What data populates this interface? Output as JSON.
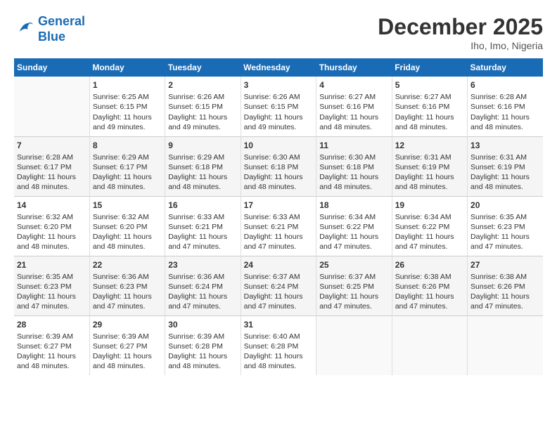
{
  "header": {
    "logo_line1": "General",
    "logo_line2": "Blue",
    "month": "December 2025",
    "location": "Iho, Imo, Nigeria"
  },
  "weekdays": [
    "Sunday",
    "Monday",
    "Tuesday",
    "Wednesday",
    "Thursday",
    "Friday",
    "Saturday"
  ],
  "rows": [
    [
      {
        "day": "",
        "sunrise": "",
        "sunset": "",
        "daylight": ""
      },
      {
        "day": "1",
        "sunrise": "Sunrise: 6:25 AM",
        "sunset": "Sunset: 6:15 PM",
        "daylight": "Daylight: 11 hours and 49 minutes."
      },
      {
        "day": "2",
        "sunrise": "Sunrise: 6:26 AM",
        "sunset": "Sunset: 6:15 PM",
        "daylight": "Daylight: 11 hours and 49 minutes."
      },
      {
        "day": "3",
        "sunrise": "Sunrise: 6:26 AM",
        "sunset": "Sunset: 6:15 PM",
        "daylight": "Daylight: 11 hours and 49 minutes."
      },
      {
        "day": "4",
        "sunrise": "Sunrise: 6:27 AM",
        "sunset": "Sunset: 6:16 PM",
        "daylight": "Daylight: 11 hours and 48 minutes."
      },
      {
        "day": "5",
        "sunrise": "Sunrise: 6:27 AM",
        "sunset": "Sunset: 6:16 PM",
        "daylight": "Daylight: 11 hours and 48 minutes."
      },
      {
        "day": "6",
        "sunrise": "Sunrise: 6:28 AM",
        "sunset": "Sunset: 6:16 PM",
        "daylight": "Daylight: 11 hours and 48 minutes."
      }
    ],
    [
      {
        "day": "7",
        "sunrise": "Sunrise: 6:28 AM",
        "sunset": "Sunset: 6:17 PM",
        "daylight": "Daylight: 11 hours and 48 minutes."
      },
      {
        "day": "8",
        "sunrise": "Sunrise: 6:29 AM",
        "sunset": "Sunset: 6:17 PM",
        "daylight": "Daylight: 11 hours and 48 minutes."
      },
      {
        "day": "9",
        "sunrise": "Sunrise: 6:29 AM",
        "sunset": "Sunset: 6:18 PM",
        "daylight": "Daylight: 11 hours and 48 minutes."
      },
      {
        "day": "10",
        "sunrise": "Sunrise: 6:30 AM",
        "sunset": "Sunset: 6:18 PM",
        "daylight": "Daylight: 11 hours and 48 minutes."
      },
      {
        "day": "11",
        "sunrise": "Sunrise: 6:30 AM",
        "sunset": "Sunset: 6:18 PM",
        "daylight": "Daylight: 11 hours and 48 minutes."
      },
      {
        "day": "12",
        "sunrise": "Sunrise: 6:31 AM",
        "sunset": "Sunset: 6:19 PM",
        "daylight": "Daylight: 11 hours and 48 minutes."
      },
      {
        "day": "13",
        "sunrise": "Sunrise: 6:31 AM",
        "sunset": "Sunset: 6:19 PM",
        "daylight": "Daylight: 11 hours and 48 minutes."
      }
    ],
    [
      {
        "day": "14",
        "sunrise": "Sunrise: 6:32 AM",
        "sunset": "Sunset: 6:20 PM",
        "daylight": "Daylight: 11 hours and 48 minutes."
      },
      {
        "day": "15",
        "sunrise": "Sunrise: 6:32 AM",
        "sunset": "Sunset: 6:20 PM",
        "daylight": "Daylight: 11 hours and 48 minutes."
      },
      {
        "day": "16",
        "sunrise": "Sunrise: 6:33 AM",
        "sunset": "Sunset: 6:21 PM",
        "daylight": "Daylight: 11 hours and 47 minutes."
      },
      {
        "day": "17",
        "sunrise": "Sunrise: 6:33 AM",
        "sunset": "Sunset: 6:21 PM",
        "daylight": "Daylight: 11 hours and 47 minutes."
      },
      {
        "day": "18",
        "sunrise": "Sunrise: 6:34 AM",
        "sunset": "Sunset: 6:22 PM",
        "daylight": "Daylight: 11 hours and 47 minutes."
      },
      {
        "day": "19",
        "sunrise": "Sunrise: 6:34 AM",
        "sunset": "Sunset: 6:22 PM",
        "daylight": "Daylight: 11 hours and 47 minutes."
      },
      {
        "day": "20",
        "sunrise": "Sunrise: 6:35 AM",
        "sunset": "Sunset: 6:23 PM",
        "daylight": "Daylight: 11 hours and 47 minutes."
      }
    ],
    [
      {
        "day": "21",
        "sunrise": "Sunrise: 6:35 AM",
        "sunset": "Sunset: 6:23 PM",
        "daylight": "Daylight: 11 hours and 47 minutes."
      },
      {
        "day": "22",
        "sunrise": "Sunrise: 6:36 AM",
        "sunset": "Sunset: 6:23 PM",
        "daylight": "Daylight: 11 hours and 47 minutes."
      },
      {
        "day": "23",
        "sunrise": "Sunrise: 6:36 AM",
        "sunset": "Sunset: 6:24 PM",
        "daylight": "Daylight: 11 hours and 47 minutes."
      },
      {
        "day": "24",
        "sunrise": "Sunrise: 6:37 AM",
        "sunset": "Sunset: 6:24 PM",
        "daylight": "Daylight: 11 hours and 47 minutes."
      },
      {
        "day": "25",
        "sunrise": "Sunrise: 6:37 AM",
        "sunset": "Sunset: 6:25 PM",
        "daylight": "Daylight: 11 hours and 47 minutes."
      },
      {
        "day": "26",
        "sunrise": "Sunrise: 6:38 AM",
        "sunset": "Sunset: 6:26 PM",
        "daylight": "Daylight: 11 hours and 47 minutes."
      },
      {
        "day": "27",
        "sunrise": "Sunrise: 6:38 AM",
        "sunset": "Sunset: 6:26 PM",
        "daylight": "Daylight: 11 hours and 47 minutes."
      }
    ],
    [
      {
        "day": "28",
        "sunrise": "Sunrise: 6:39 AM",
        "sunset": "Sunset: 6:27 PM",
        "daylight": "Daylight: 11 hours and 48 minutes."
      },
      {
        "day": "29",
        "sunrise": "Sunrise: 6:39 AM",
        "sunset": "Sunset: 6:27 PM",
        "daylight": "Daylight: 11 hours and 48 minutes."
      },
      {
        "day": "30",
        "sunrise": "Sunrise: 6:39 AM",
        "sunset": "Sunset: 6:28 PM",
        "daylight": "Daylight: 11 hours and 48 minutes."
      },
      {
        "day": "31",
        "sunrise": "Sunrise: 6:40 AM",
        "sunset": "Sunset: 6:28 PM",
        "daylight": "Daylight: 11 hours and 48 minutes."
      },
      {
        "day": "",
        "sunrise": "",
        "sunset": "",
        "daylight": ""
      },
      {
        "day": "",
        "sunrise": "",
        "sunset": "",
        "daylight": ""
      },
      {
        "day": "",
        "sunrise": "",
        "sunset": "",
        "daylight": ""
      }
    ]
  ]
}
